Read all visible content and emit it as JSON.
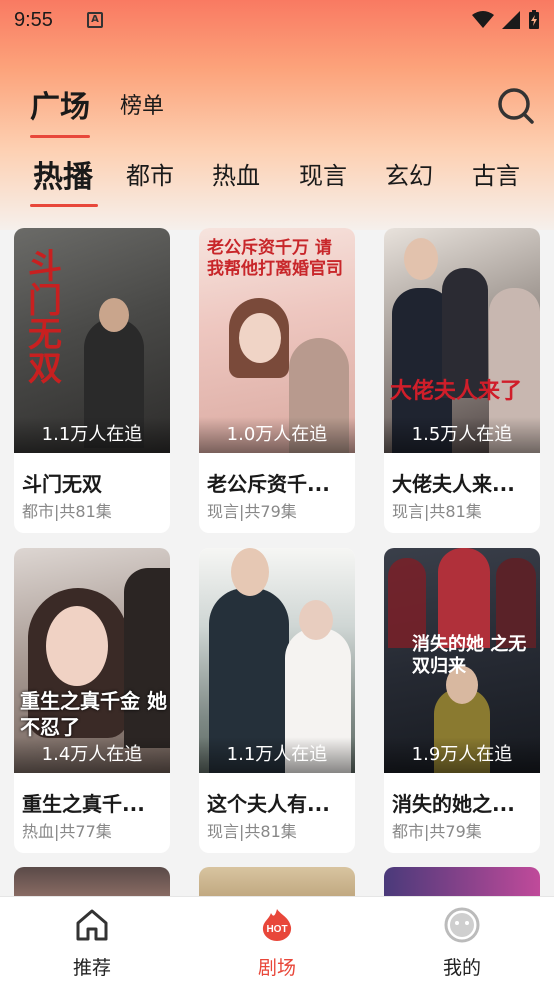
{
  "status_bar": {
    "time": "9:55",
    "notification_letter": "A"
  },
  "header": {
    "tabs": [
      {
        "label": "广场",
        "active": true
      },
      {
        "label": "榜单",
        "active": false
      }
    ]
  },
  "categories": [
    {
      "label": "热播",
      "active": true
    },
    {
      "label": "都市"
    },
    {
      "label": "热血"
    },
    {
      "label": "现言"
    },
    {
      "label": "玄幻"
    },
    {
      "label": "古言"
    }
  ],
  "dramas": [
    {
      "title": "斗门无双",
      "meta": "都市|共81集",
      "followers": "1.1万人在追",
      "poster_text": "斗门无双"
    },
    {
      "title": "老公斥资千...",
      "meta": "现言|共79集",
      "followers": "1.0万人在追",
      "poster_text": "老公斥资千万 请我帮他打离婚官司"
    },
    {
      "title": "大佬夫人来...",
      "meta": "现言|共81集",
      "followers": "1.5万人在追",
      "poster_text": "大佬夫人来了"
    },
    {
      "title": "重生之真千...",
      "meta": "热血|共77集",
      "followers": "1.4万人在追",
      "poster_text": "重生之真千金 她不忍了"
    },
    {
      "title": "这个夫人有...",
      "meta": "现言|共81集",
      "followers": "1.1万人在追",
      "poster_text": ""
    },
    {
      "title": "消失的她之...",
      "meta": "都市|共79集",
      "followers": "1.9万人在追",
      "poster_text": "消失的她 之无双归来"
    }
  ],
  "bottom_nav": [
    {
      "label": "推荐",
      "icon": "home-icon",
      "active": false
    },
    {
      "label": "剧场",
      "icon": "hot-icon",
      "active": true,
      "badge": "HOT"
    },
    {
      "label": "我的",
      "icon": "profile-icon",
      "active": false
    }
  ],
  "colors": {
    "accent": "#e8473a",
    "header_gradient_top": "#f97a62"
  }
}
